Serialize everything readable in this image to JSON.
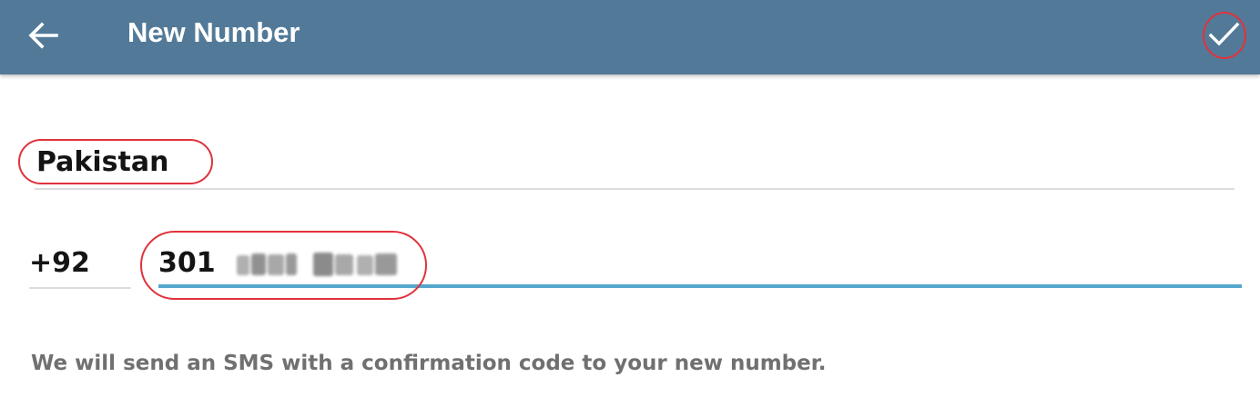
{
  "appbar": {
    "title": "New Number",
    "back_icon": "arrow-left-icon",
    "done_icon": "checkmark-icon",
    "background": "#527a98"
  },
  "form": {
    "country": "Pakistan",
    "country_code": "+92",
    "phone_number": "301"
  },
  "hint": "We will send an SMS with a confirmation code to your new number.",
  "colors": {
    "accent_line": "#55a7cd",
    "annotation_circle": "#e0323c"
  }
}
